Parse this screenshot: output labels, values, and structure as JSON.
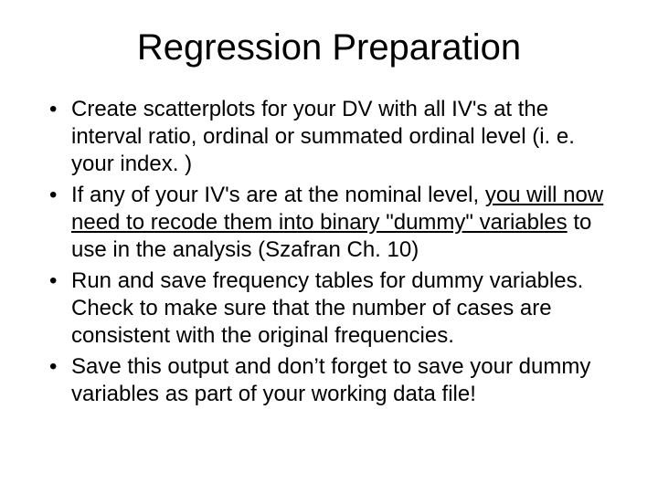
{
  "slide": {
    "title": "Regression Preparation",
    "bullets": [
      {
        "pre": "Create scatterplots for your DV with all IV's at the interval ratio, ordinal or summated ordinal level (i. e. your index. )",
        "underlined": "",
        "post": ""
      },
      {
        "pre": "If any of your IV's are at the nominal level, ",
        "underlined": "you will now need to recode them into binary \"dummy\" variables",
        "post": " to use in the analysis (Szafran Ch. 10)"
      },
      {
        "pre": "Run and save frequency tables for dummy variables. Check to make sure that the number of cases are consistent with the original frequencies.",
        "underlined": "",
        "post": ""
      },
      {
        "pre": "Save this output and don’t forget to save your dummy variables as part of your working data file!",
        "underlined": "",
        "post": ""
      }
    ]
  }
}
